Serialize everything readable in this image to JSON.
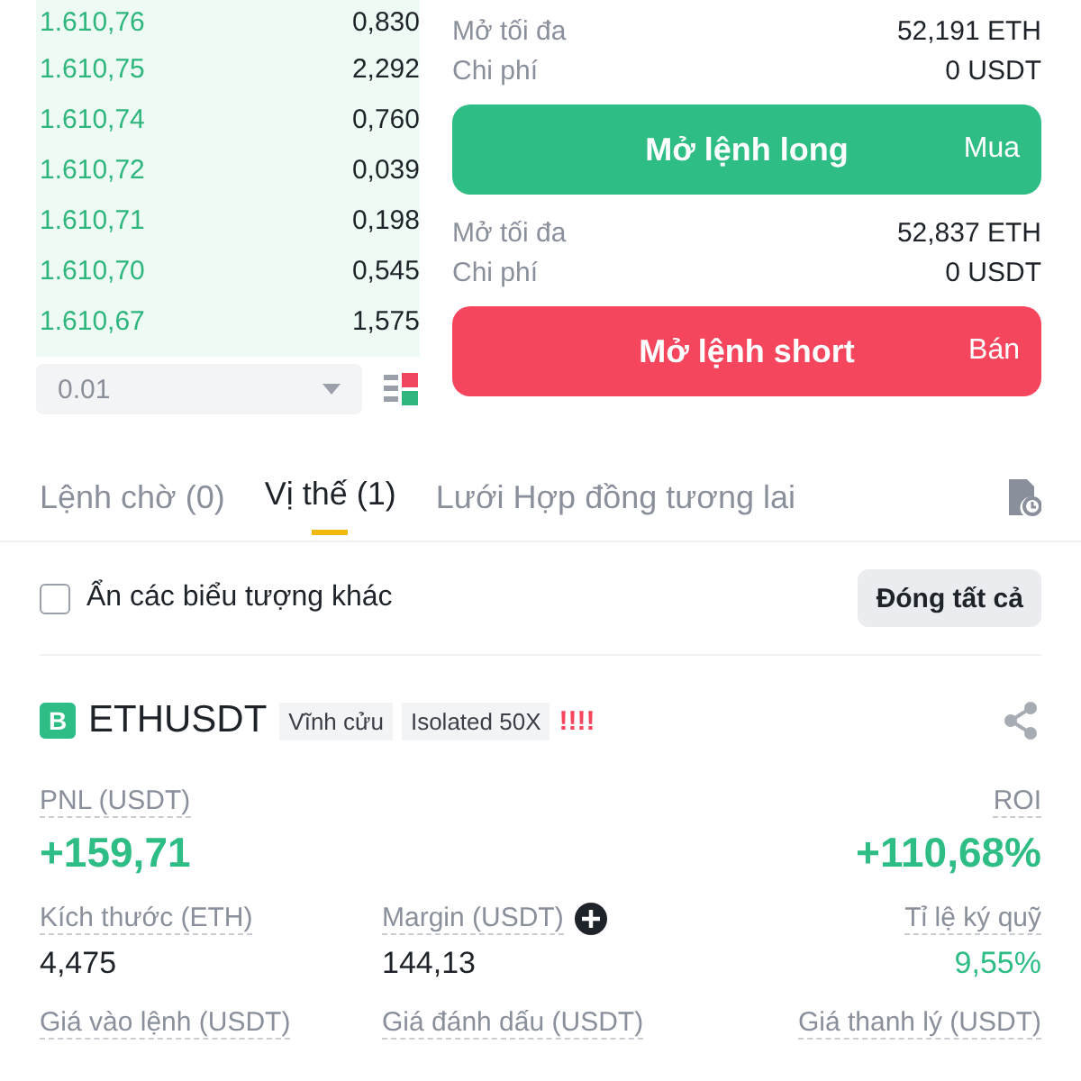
{
  "order_book": {
    "rows": [
      {
        "price": "1.610,76",
        "amount": "0,830"
      },
      {
        "price": "1.610,75",
        "amount": "2,292"
      },
      {
        "price": "1.610,74",
        "amount": "0,760"
      },
      {
        "price": "1.610,72",
        "amount": "0,039"
      },
      {
        "price": "1.610,71",
        "amount": "0,198"
      },
      {
        "price": "1.610,70",
        "amount": "0,545"
      },
      {
        "price": "1.610,67",
        "amount": "1,575"
      }
    ],
    "tick_size": "0.01"
  },
  "actions": [
    {
      "kind": "long",
      "rows": [
        {
          "label": "Mở tối đa",
          "value": "52,191 ETH"
        },
        {
          "label": "Chi phí",
          "value": "0 USDT"
        }
      ],
      "button": "Mở lệnh long",
      "side": "Mua"
    },
    {
      "kind": "short",
      "rows": [
        {
          "label": "Mở tối đa",
          "value": "52,837 ETH"
        },
        {
          "label": "Chi phí",
          "value": "0 USDT"
        }
      ],
      "button": "Mở lệnh short",
      "side": "Bán"
    }
  ],
  "tabs": [
    {
      "label": "Lệnh chờ (0)",
      "selected": false
    },
    {
      "label": "Vị thế (1)",
      "selected": true
    },
    {
      "label": "Lưới Hợp đồng tương lai",
      "selected": false
    }
  ],
  "hide_other_symbols": {
    "label": "Ẩn các biểu tượng khác",
    "checked": false
  },
  "close_all": "Đóng tất cả",
  "position": {
    "badge": "B",
    "symbol": "ETHUSDT",
    "tags": [
      "Vĩnh cửu",
      "Isolated 50X"
    ],
    "warning": "!!!!",
    "headline": [
      {
        "label": "PNL (USDT)",
        "value": "+159,71",
        "kind": "gain"
      },
      {
        "label": "ROI",
        "value": "+110,68%",
        "kind": "gain"
      }
    ],
    "stats": [
      {
        "label": "Kích thước (ETH)",
        "value": "4,475",
        "kind": "plain"
      },
      {
        "label": "Margin (USDT)",
        "value": "144,13",
        "kind": "plain",
        "add": true
      },
      {
        "label": "Tỉ lệ ký quỹ",
        "value": "9,55%",
        "kind": "gain"
      },
      {
        "label": "Giá vào lệnh (USDT)"
      },
      {
        "label": "Giá đánh dấu (USDT)"
      },
      {
        "label": "Giá thanh lý (USDT)"
      }
    ]
  }
}
